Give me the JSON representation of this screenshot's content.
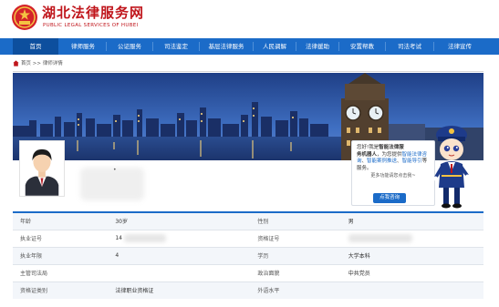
{
  "header": {
    "title": "湖北法律服务网",
    "subtitle": "PUBLIC LEGAL SERVICES OF HUBEI"
  },
  "nav": {
    "items": [
      {
        "label": "首页",
        "active": true
      },
      {
        "label": "律师服务",
        "active": false
      },
      {
        "label": "公证服务",
        "active": false
      },
      {
        "label": "司法鉴定",
        "active": false
      },
      {
        "label": "基层法律服务",
        "active": false
      },
      {
        "label": "人民调解",
        "active": false
      },
      {
        "label": "法律援助",
        "active": false
      },
      {
        "label": "安置帮教",
        "active": false
      },
      {
        "label": "司法考试",
        "active": false
      },
      {
        "label": "法律宣传",
        "active": false
      }
    ]
  },
  "breadcrumb": {
    "home": "首页",
    "sep": ">>",
    "current": "律师详情"
  },
  "profile": {
    "name_mark": "•"
  },
  "assistant": {
    "greeting": "您好!我是",
    "bot_name_1": "智能法律服",
    "bot_name_2": "务机器人",
    "intro": "，为您提供",
    "link_1": "智能法律咨询",
    "comma_1": "、",
    "link_2": "智能案例推送",
    "comma_2": "、",
    "link_3": "智能导引",
    "suffix": "等服务。",
    "more": "更多功能请您点击我~",
    "button": "点我咨询"
  },
  "details": {
    "rows": [
      {
        "label1": "年龄",
        "value1": "30岁",
        "label2": "性别",
        "value2": "男"
      },
      {
        "label1": "执业证号",
        "value1": "14",
        "label2": "资格证号",
        "value2": ""
      },
      {
        "label1": "执业年限",
        "value1": "4",
        "label2": "学历",
        "value2": "大学本科"
      },
      {
        "label1": "主管司法局",
        "value1": "",
        "label2": "政治面貌",
        "value2": "中共党员"
      },
      {
        "label1": "资格证类别",
        "value1": "法律职业资格证",
        "label2": "外语水平",
        "value2": ""
      }
    ]
  },
  "colors": {
    "brand_red": "#c0161c",
    "nav_blue": "#1b6bc8",
    "nav_active": "#0d4f9e"
  }
}
